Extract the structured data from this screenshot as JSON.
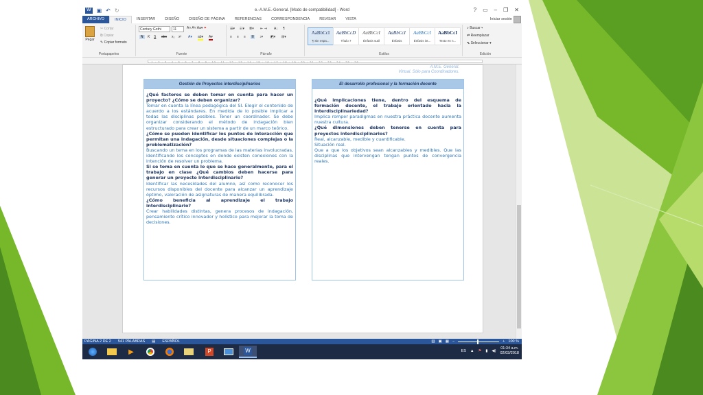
{
  "title_bar": {
    "document_title": "e.-A.M.E.-General. [Modo de compatibilidad] - Word",
    "help": "?",
    "minimize": "–",
    "restore": "❐",
    "close": "✕"
  },
  "tabs": [
    "ARCHIVO",
    "INICIO",
    "INSERTAR",
    "DISEÑO",
    "DISEÑO DE PÁGINA",
    "REFERENCIAS",
    "CORRESPONDENCIA",
    "REVISAR",
    "VISTA"
  ],
  "sign_in": "Iniciar sesión",
  "ribbon": {
    "clipboard": {
      "paste": "Pegar",
      "cut": "Cortar",
      "copy": "Copiar",
      "format_painter": "Copiar formato",
      "label": "Portapapeles"
    },
    "font": {
      "name": "Century Gothi",
      "size": "11",
      "bold": "N",
      "italic": "K",
      "underline": "S",
      "strike": "abc",
      "sub": "x₂",
      "sup": "x²",
      "label": "Fuente"
    },
    "paragraph": {
      "label": "Párrafo"
    },
    "styles": {
      "items": [
        {
          "sample": "AaBbCcI",
          "name": "¶ Sin espa..."
        },
        {
          "sample": "AaBbCcD",
          "name": "Título 7"
        },
        {
          "sample": "AaBbCcI",
          "name": "Énfasis sutil"
        },
        {
          "sample": "AaBbCcI",
          "name": "Énfasis"
        },
        {
          "sample": "AaBbCcI",
          "name": "Énfasis int..."
        },
        {
          "sample": "AaBbCcI",
          "name": "Texto en n..."
        }
      ],
      "label": "Estilos"
    },
    "editing": {
      "find": "Buscar",
      "replace": "Reemplazar",
      "select": "Seleccionar",
      "label": "Edición"
    }
  },
  "document": {
    "header_note_1": "A.M.E. General.",
    "header_note_2": "Virtual. Sólo para Coordinadores.",
    "left_box": {
      "title": "Gestión de Proyectos interdisciplinarios",
      "q1": "¿Qué factores se deben tomar en cuenta para hacer un proyecto? ¿Cómo se deben organizar?",
      "a1": "Tomar en cuenta la línea pedagógica del SI. Elegir el contenido de acuerdo a los estándares. En medida de lo posible implicar a todas las disciplinas posibles. Tener un coordinador. Se debe organizar considerando el método de indagación bien estructurado para crear un sistema a partir de un marco teórico.",
      "q2": "¿Cómo se pueden identificar los puntos de interacción que permitan una indagación, desde situaciones complejas o la problematización?",
      "a2": "Buscando un tema en los programas de las materias involucradas, identificando los conceptos en donde existen conexiones con la intención de resolver un problema.",
      "q3": "Si se toma en cuenta lo que se hace generalmente, para el trabajo en clase ¿Qué cambios deben hacerse para generar un proyecto interdisciplinario?",
      "a3": "Identificar las necesidades del alumno, así como reconocer los recursos disponibles del docente para alcanzar un aprendizaje óptimo, valoración de asignaturas de manera equilibrada.",
      "q4": "¿Cómo beneficia al aprendizaje el trabajo interdisciplinario?",
      "a4": "Crear habilidades distintas, genera procesos de indagación, pensamiento crítico innovador y holístico para mejorar la toma de decisiones."
    },
    "right_box": {
      "title": "El desarrollo profesional y la formación docente",
      "q1": "¿Qué implicaciones tiene, dentro del esquema de formación docente, el trabajo orientado hacia la interdisciplinariedad?",
      "a1": "Implica romper paradigmas en nuestra práctica docente aumenta nuestra cultura.",
      "q2": "¿Qué dimensiones deben tenerse en cuenta para proyectos interdisciplinarios?",
      "a2": "Real, alcanzable, medible y cuantificable.",
      "a3": "Situación real.",
      "a4": "Que a que los objetivos sean alcanzables y medibles. Que las disciplinas que intervengan tengan puntos de convergencia reales."
    }
  },
  "status_bar": {
    "page": "PÁGINA 2 DE 2",
    "words": "541 PALABRAS",
    "language": "ESPAÑOL",
    "zoom": "100 %"
  },
  "taskbar": {
    "lang": "ES",
    "time": "01:34 a.m.",
    "date": "02/03/2018"
  },
  "colors": {
    "word_blue": "#2b579a",
    "green_dark": "#4a8a1e",
    "green_mid": "#76b82a",
    "green_light": "#a8d04e",
    "box_header": "#a9c8e8",
    "question_text": "#1f3864",
    "answer_text": "#2e75b6"
  }
}
